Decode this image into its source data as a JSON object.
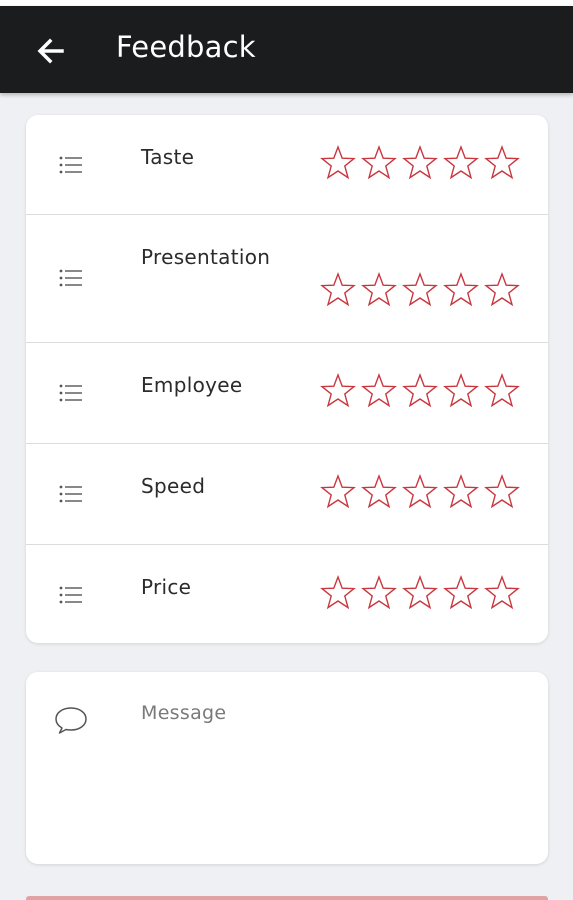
{
  "header": {
    "title": "Feedback",
    "back_icon": "arrow-left-icon"
  },
  "ratings": {
    "max_stars": 5,
    "star_color": "#c9363e",
    "items": [
      {
        "label": "Taste",
        "value": 0
      },
      {
        "label": "Presentation",
        "value": 0
      },
      {
        "label": "Employee",
        "value": 0
      },
      {
        "label": "Speed",
        "value": 0
      },
      {
        "label": "Price",
        "value": 0
      }
    ]
  },
  "message": {
    "placeholder": "Message",
    "value": "",
    "icon": "speech-bubble-icon"
  }
}
